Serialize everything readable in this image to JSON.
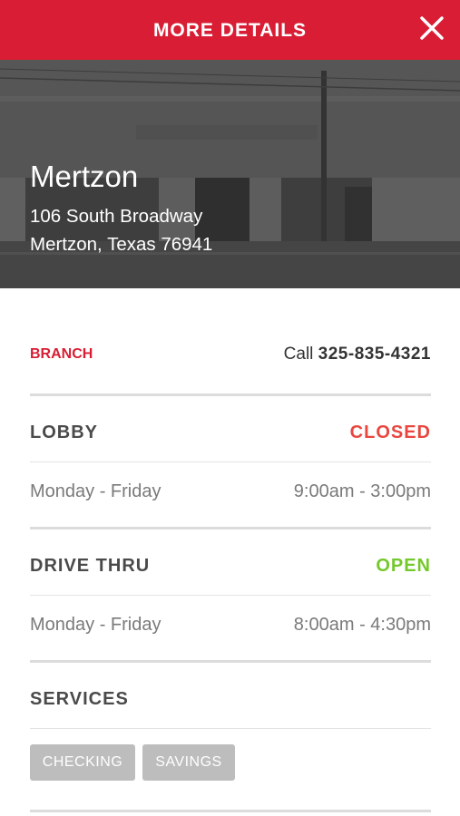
{
  "header": {
    "title": "MORE DETAILS",
    "close_icon": "close-icon"
  },
  "location": {
    "name": "Mertzon",
    "address_line1": "106 South Broadway",
    "address_line2": "Mertzon, Texas 76941"
  },
  "branch": {
    "label": "BRANCH",
    "call_prefix": "Call",
    "phone": "325-835-4321"
  },
  "lobby": {
    "title": "LOBBY",
    "status": "CLOSED",
    "days": "Monday - Friday",
    "hours": "9:00am - 3:00pm"
  },
  "drive_thru": {
    "title": "DRIVE THRU",
    "status": "OPEN",
    "days": "Monday - Friday",
    "hours": "8:00am - 4:30pm"
  },
  "services": {
    "title": "SERVICES",
    "tags": [
      "CHECKING",
      "SAVINGS"
    ]
  },
  "colors": {
    "brand_red": "#d81d34",
    "closed_red": "#e8463f",
    "open_green": "#73c92b",
    "tag_gray": "#bdbdbd"
  }
}
